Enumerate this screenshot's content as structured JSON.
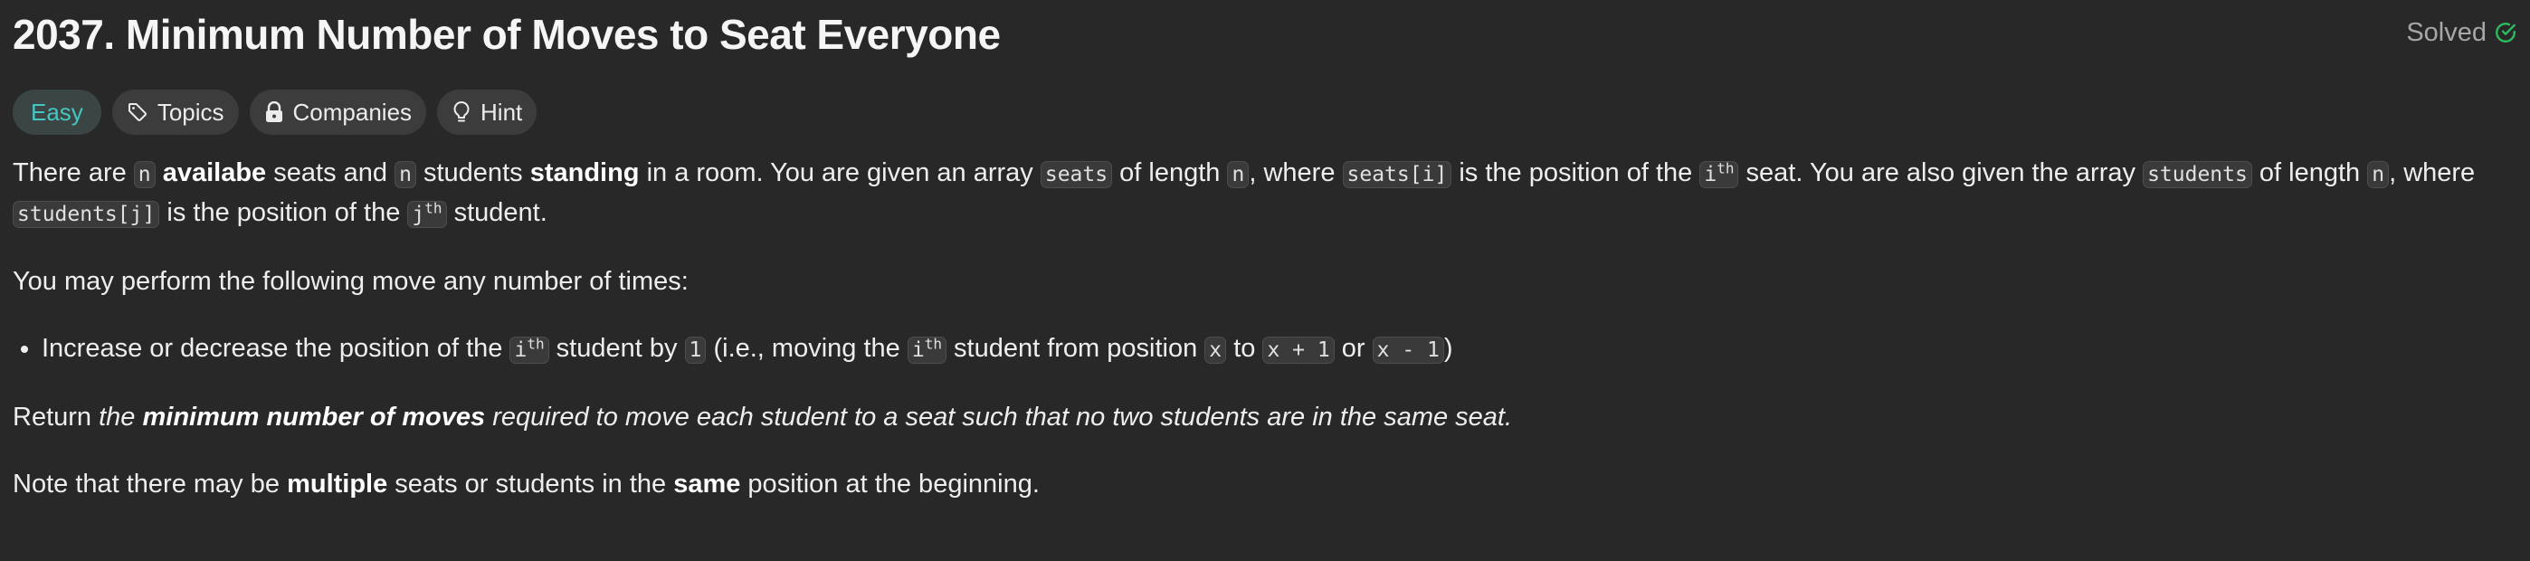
{
  "problem": {
    "title": "2037. Minimum Number of Moves to Seat Everyone",
    "status": "Solved",
    "status_icon": "check-circle-icon",
    "colors": {
      "easy": "#46c6c2",
      "solved_check": "#2cbb5d",
      "background": "#282828"
    }
  },
  "tags": {
    "difficulty": "Easy",
    "topics": "Topics",
    "companies": "Companies",
    "hint": "Hint"
  },
  "desc": {
    "p1": {
      "t1": "There are ",
      "c_n1": "n",
      "b_available": "availabe",
      "t2": " seats and ",
      "c_n2": "n",
      "t3": " students ",
      "b_standing": "standing",
      "t4": " in a room. You are given an array ",
      "c_seats": "seats",
      "t5": " of length ",
      "c_n3": "n",
      "t6": ", where ",
      "c_seats_i": "seats[i]",
      "t7": " is the position of the ",
      "c_i1": "i",
      "sup_th": "th",
      "t8": " seat. You are also given the array ",
      "c_students": "students",
      "t9": " of length ",
      "c_n4": "n",
      "t10": ", where ",
      "c_students_j": "students[j]",
      "t11": " is the position of the ",
      "c_j": "j",
      "t12": " student."
    },
    "p2": "You may perform the following move any number of times:",
    "bullet": {
      "t1": "Increase or decrease the position of the ",
      "c_i": "i",
      "sup_th": "th",
      "t2": " student by ",
      "c_1": "1",
      "t3": " (i.e., moving the ",
      "t4": " student from position ",
      "c_x": "x",
      "t5": " to ",
      "c_xp1": "x + 1",
      "t6": " or ",
      "c_xm1": "x - 1",
      "t7": ")"
    },
    "p3": {
      "t1": "Return ",
      "i1": "the ",
      "b1": "minimum number of moves",
      "i2": " required to move each student to a seat such that no two students are in the same seat."
    },
    "p4": {
      "t1": "Note that there may be ",
      "b1": "multiple",
      "t2": " seats or students in the ",
      "b2": "same",
      "t3": " position at the beginning."
    }
  }
}
